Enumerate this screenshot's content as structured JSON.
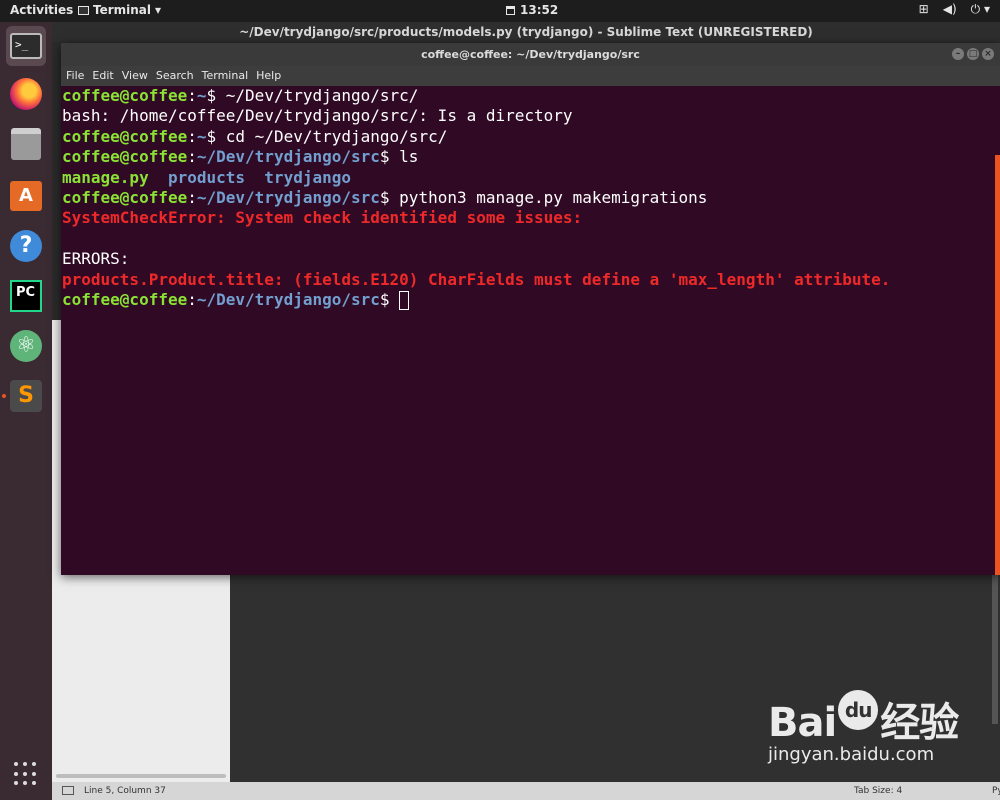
{
  "topbar": {
    "activities": "Activities",
    "app_menu": "Terminal",
    "clock": "13:52",
    "tray": [
      "network-icon",
      "volume-icon",
      "power-icon"
    ]
  },
  "dock": {
    "items": [
      "terminal-icon",
      "firefox-icon",
      "files-icon",
      "software-store-icon",
      "help-icon",
      "pycharm-icon",
      "atom-icon",
      "sublime-text-icon"
    ],
    "active_index": 0,
    "running_dot_index": 7
  },
  "sublime": {
    "title": "~/Dev/trydjango/src/products/models.py (trydjango) - Sublime Text (UNREGISTERED)",
    "status_position": "Line 5, Column 37",
    "status_tab_size": "Tab Size: 4",
    "status_language": "Python"
  },
  "terminal": {
    "title": "coffee@coffee: ~/Dev/trydjango/src",
    "menu": [
      "File",
      "Edit",
      "View",
      "Search",
      "Terminal",
      "Help"
    ],
    "lines": {
      "l1_user": "coffee@coffee",
      "l1_path": "~",
      "l1_cmd": "$ ~/Dev/trydjango/src/",
      "l2": "bash: /home/coffee/Dev/trydjango/src/: Is a directory",
      "l3_user": "coffee@coffee",
      "l3_path": "~",
      "l3_cmd": "$ cd ~/Dev/trydjango/src/",
      "l4_user": "coffee@coffee",
      "l4_path": "~/Dev/trydjango/src",
      "l4_cmd": "$ ls",
      "l5_file": "manage.py",
      "l5_dir1": "products",
      "l5_dir2": "trydjango",
      "l6_user": "coffee@coffee",
      "l6_path": "~/Dev/trydjango/src",
      "l6_cmd": "$ python3 manage.py makemigrations",
      "l7": "SystemCheckError: System check identified some issues:",
      "l9": "ERRORS:",
      "l10": "products.Product.title: (fields.E120) CharFields must define a 'max_length' attribute.",
      "l11_user": "coffee@coffee",
      "l11_path": "~/Dev/trydjango/src",
      "l11_cmd": "$ "
    },
    "colors": {
      "background": "#300a24",
      "user": "#8ae234",
      "path": "#729fcf",
      "error": "#ef2929"
    }
  },
  "watermark": {
    "logo_left": "Bai",
    "logo_right": "经验",
    "url": "jingyan.baidu.com"
  }
}
